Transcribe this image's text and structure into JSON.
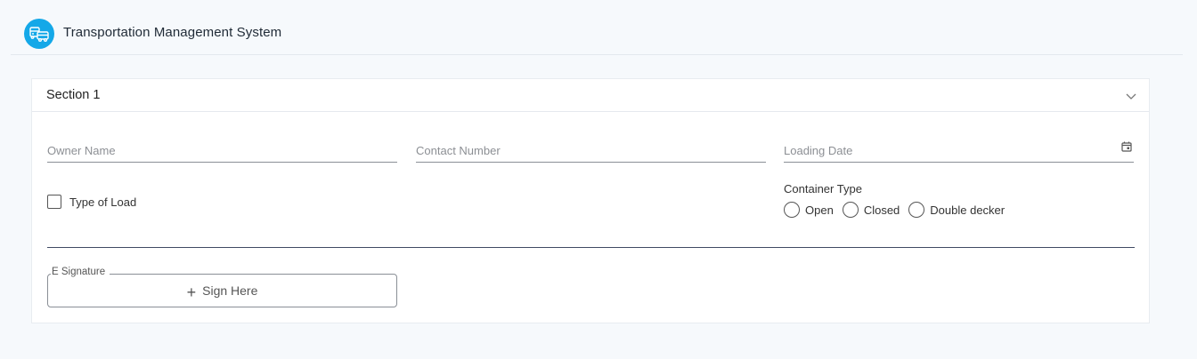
{
  "header": {
    "title": "Transportation Management System",
    "logo_icon": "truck-icon",
    "logo_color": "#14a8e8"
  },
  "section": {
    "title": "Section 1",
    "toggle_icon": "chevron-down-icon",
    "fields": {
      "owner_name": {
        "placeholder": "Owner Name",
        "value": ""
      },
      "contact_number": {
        "placeholder": "Contact Number",
        "value": ""
      },
      "loading_date": {
        "placeholder": "Loading Date",
        "value": "",
        "icon": "calendar-icon"
      }
    },
    "type_of_load": {
      "label": "Type of Load",
      "checked": false
    },
    "container_type": {
      "label": "Container Type",
      "options": [
        {
          "label": "Open",
          "selected": false
        },
        {
          "label": "Closed",
          "selected": false
        },
        {
          "label": "Double decker",
          "selected": false
        }
      ]
    },
    "signature": {
      "legend": "E Signature",
      "action_label": "Sign Here",
      "action_icon": "plus-icon"
    }
  }
}
